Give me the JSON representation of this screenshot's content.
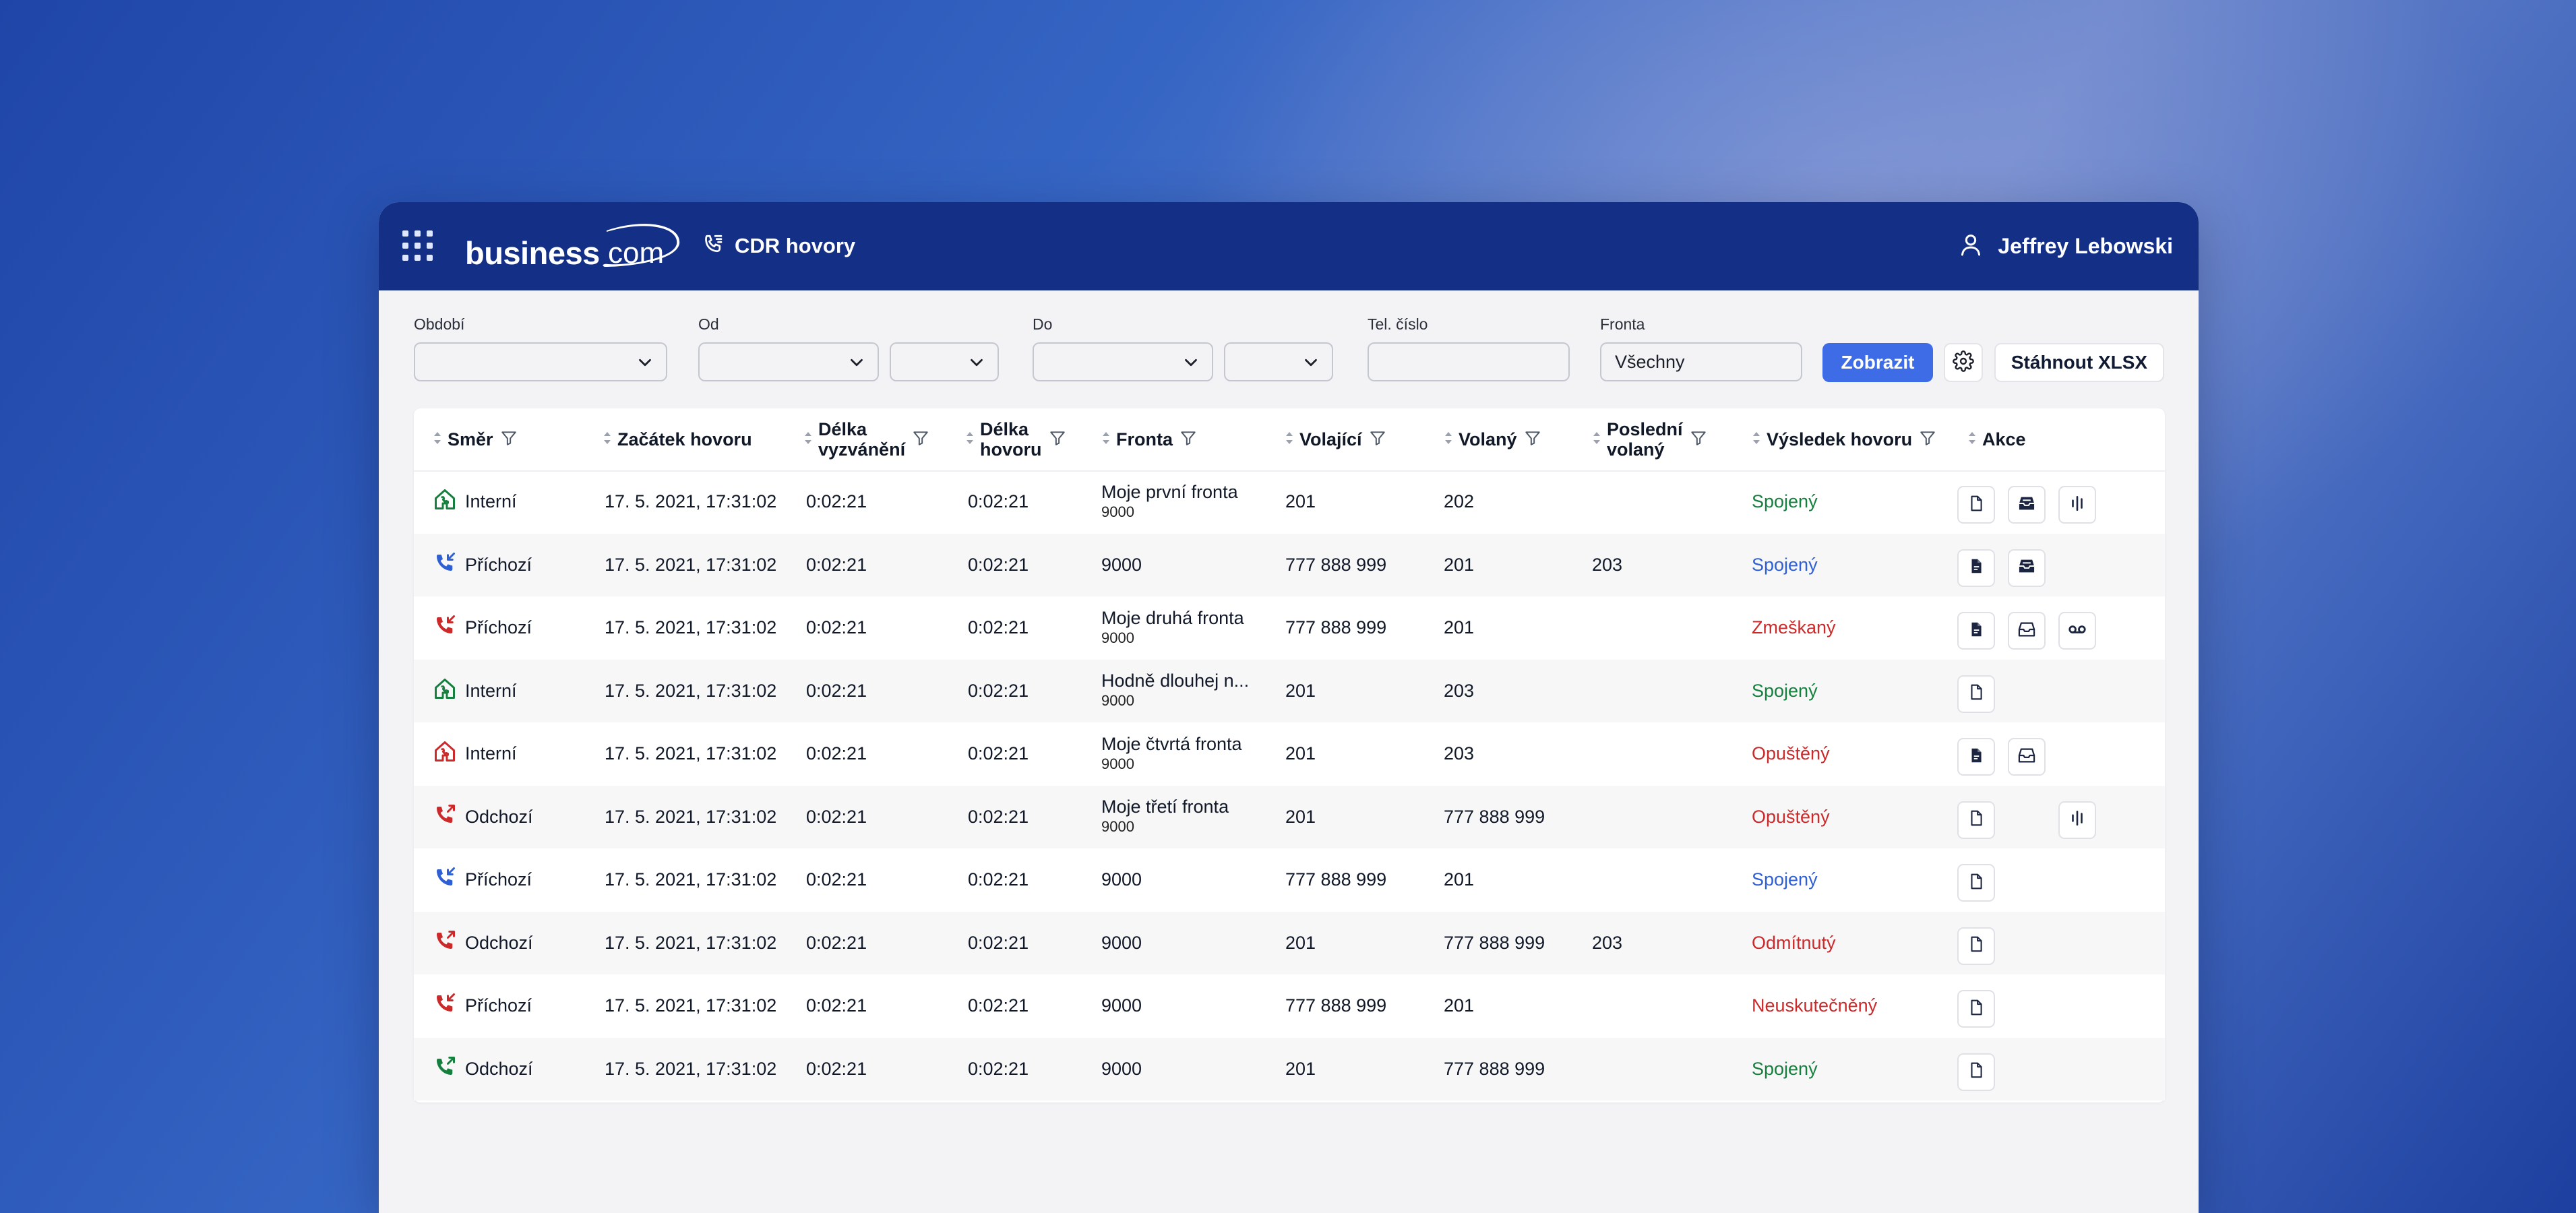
{
  "header": {
    "logo_text": "business",
    "logo_suffix": "com",
    "page_title": "CDR hovory",
    "user_name": "Jeffrey Lebowski"
  },
  "filters": {
    "obdobi_label": "Období",
    "od_label": "Od",
    "do_label": "Do",
    "tel_label": "Tel. číslo",
    "tel_value": "",
    "fronta_label": "Fronta",
    "fronta_value": "Všechny",
    "show_button": "Zobrazit",
    "download_button": "Stáhnout XLSX"
  },
  "columns": {
    "smer": "Směr",
    "zacatek": "Začátek hovoru",
    "delka_vyzv_1": "Délka",
    "delka_vyzv_2": "vyzvánění",
    "delka_hov_1": "Délka",
    "delka_hov_2": "hovoru",
    "fronta": "Fronta",
    "volajici": "Volající",
    "volany": "Volaný",
    "posledni_1": "Poslední",
    "posledni_2": "volaný",
    "vysledek": "Výsledek hovoru",
    "akce": "Akce"
  },
  "colors": {
    "header_bg": "#142f86",
    "primary": "#3e6be6",
    "green": "#15803d",
    "blue": "#2e5fd4",
    "red": "#cc2a2a"
  },
  "rows": [
    {
      "direction": "Interní",
      "dir_icon": "internal-call-icon",
      "dir_color": "green",
      "start": "17. 5. 2021, 17:31:02",
      "ring": "0:02:21",
      "dur": "0:02:21",
      "queue": "Moje první fronta",
      "queue_num": "9000",
      "caller": "201",
      "callee": "202",
      "last": "",
      "result": "Spojený",
      "result_color": "green",
      "actions": [
        "document",
        "archive-filled",
        "waveform"
      ]
    },
    {
      "direction": "Příchozí",
      "dir_icon": "incoming-call-icon",
      "dir_color": "blue",
      "start": "17. 5. 2021, 17:31:02",
      "ring": "0:02:21",
      "dur": "0:02:21",
      "queue": "9000",
      "queue_num": "",
      "caller": "777 888 999",
      "callee": "201",
      "last": "203",
      "result": "Spojený",
      "result_color": "blue",
      "actions": [
        "document-filled",
        "archive-filled"
      ]
    },
    {
      "direction": "Příchozí",
      "dir_icon": "incoming-call-icon",
      "dir_color": "red",
      "start": "17. 5. 2021, 17:31:02",
      "ring": "0:02:21",
      "dur": "0:02:21",
      "queue": "Moje druhá fronta",
      "queue_num": "9000",
      "caller": "777 888 999",
      "callee": "201",
      "last": "",
      "result": "Zmeškaný",
      "result_color": "red",
      "actions": [
        "document-filled",
        "archive",
        "voicemail"
      ]
    },
    {
      "direction": "Interní",
      "dir_icon": "internal-call-icon",
      "dir_color": "green",
      "start": "17. 5. 2021, 17:31:02",
      "ring": "0:02:21",
      "dur": "0:02:21",
      "queue": "Hodně dlouhej n...",
      "queue_num": "9000",
      "caller": "201",
      "callee": "203",
      "last": "",
      "result": "Spojený",
      "result_color": "green",
      "actions": [
        "document"
      ]
    },
    {
      "direction": "Interní",
      "dir_icon": "internal-call-icon",
      "dir_color": "red",
      "start": "17. 5. 2021, 17:31:02",
      "ring": "0:02:21",
      "dur": "0:02:21",
      "queue": "Moje čtvrtá fronta",
      "queue_num": "9000",
      "caller": "201",
      "callee": "203",
      "last": "",
      "result": "Opuštěný",
      "result_color": "red",
      "actions": [
        "document-filled",
        "archive"
      ]
    },
    {
      "direction": "Odchozí",
      "dir_icon": "outgoing-call-icon",
      "dir_color": "red",
      "start": "17. 5. 2021, 17:31:02",
      "ring": "0:02:21",
      "dur": "0:02:21",
      "queue": "Moje třetí fronta",
      "queue_num": "9000",
      "caller": "201",
      "callee": "777 888 999",
      "last": "",
      "result": "Opuštěný",
      "result_color": "red",
      "actions": [
        "document",
        "",
        "waveform"
      ]
    },
    {
      "direction": "Příchozí",
      "dir_icon": "incoming-call-icon",
      "dir_color": "blue",
      "start": "17. 5. 2021, 17:31:02",
      "ring": "0:02:21",
      "dur": "0:02:21",
      "queue": "9000",
      "queue_num": "",
      "caller": "777 888 999",
      "callee": "201",
      "last": "",
      "result": "Spojený",
      "result_color": "blue",
      "actions": [
        "document"
      ]
    },
    {
      "direction": "Odchozí",
      "dir_icon": "outgoing-call-icon",
      "dir_color": "red",
      "start": "17. 5. 2021, 17:31:02",
      "ring": "0:02:21",
      "dur": "0:02:21",
      "queue": "9000",
      "queue_num": "",
      "caller": "201",
      "callee": "777 888 999",
      "last": "203",
      "result": "Odmítnutý",
      "result_color": "red",
      "actions": [
        "document"
      ]
    },
    {
      "direction": "Příchozí",
      "dir_icon": "incoming-call-icon",
      "dir_color": "red",
      "start": "17. 5. 2021, 17:31:02",
      "ring": "0:02:21",
      "dur": "0:02:21",
      "queue": "9000",
      "queue_num": "",
      "caller": "777 888 999",
      "callee": "201",
      "last": "",
      "result": "Neuskutečněný",
      "result_color": "red",
      "actions": [
        "document"
      ]
    },
    {
      "direction": "Odchozí",
      "dir_icon": "outgoing-call-icon",
      "dir_color": "green",
      "start": "17. 5. 2021, 17:31:02",
      "ring": "0:02:21",
      "dur": "0:02:21",
      "queue": "9000",
      "queue_num": "",
      "caller": "201",
      "callee": "777 888 999",
      "last": "",
      "result": "Spojený",
      "result_color": "green",
      "actions": [
        "document"
      ]
    }
  ]
}
